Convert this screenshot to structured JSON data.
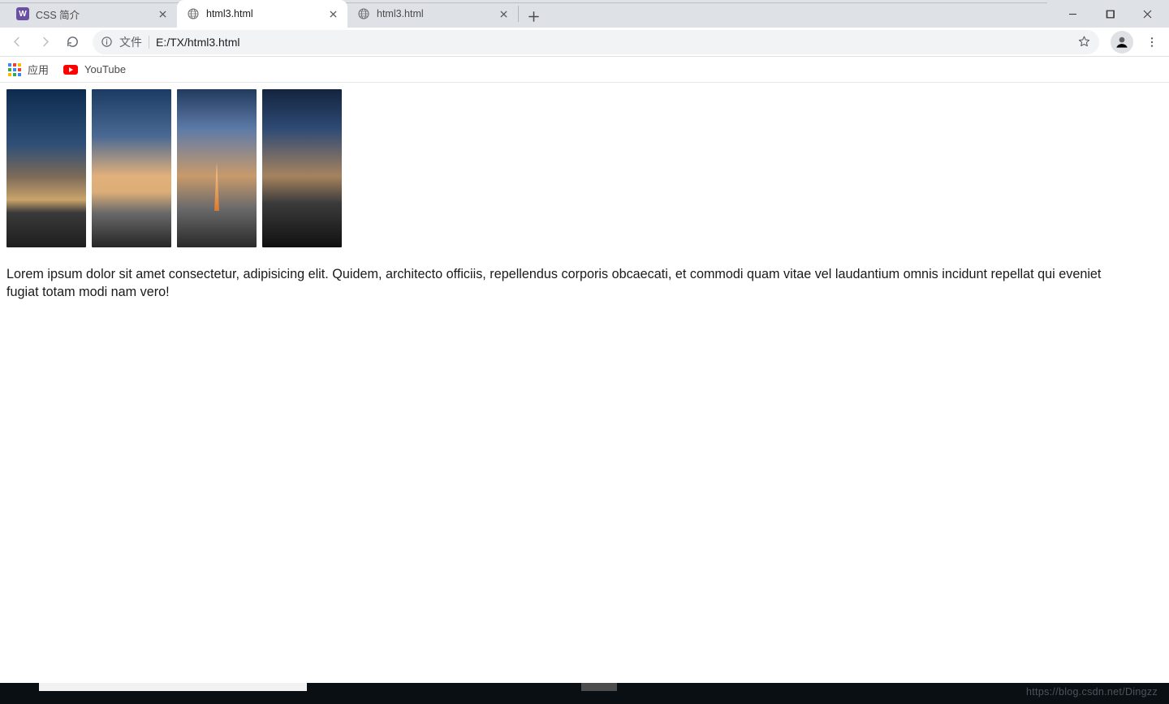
{
  "tabs": [
    {
      "title": "CSS 简介",
      "favicon": "w3"
    },
    {
      "title": "html3.html",
      "favicon": "globe",
      "active": true
    },
    {
      "title": "html3.html",
      "favicon": "globe"
    }
  ],
  "omnibox": {
    "scheme_label": "文件",
    "path": "E:/TX/html3.html"
  },
  "bookmarks": {
    "apps_label": "应用",
    "items": [
      {
        "label": "YouTube",
        "icon": "youtube"
      }
    ]
  },
  "page": {
    "images_count": 4,
    "paragraph": "Lorem ipsum dolor sit amet consectetur, adipisicing elit. Quidem, architecto officiis, repellendus corporis obcaecati, et commodi quam vitae vel laudantium omnis incidunt repellat qui eveniet fugiat totam modi nam vero!"
  },
  "watermark": "https://blog.csdn.net/Dingzz"
}
